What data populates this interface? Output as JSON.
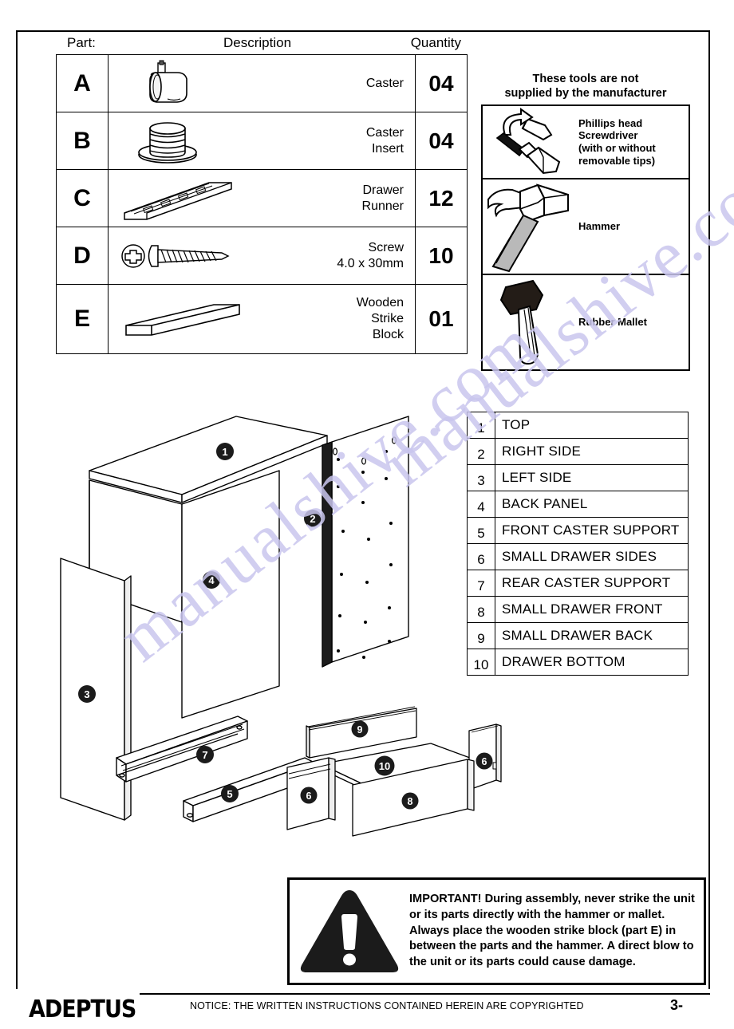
{
  "parts_table": {
    "headers": {
      "part": "Part:",
      "description": "Description",
      "quantity": "Quantity"
    },
    "rows": [
      {
        "letter": "A",
        "icon": "caster-icon",
        "description": "Caster",
        "quantity": "04"
      },
      {
        "letter": "B",
        "icon": "caster-insert-icon",
        "description": "Caster\nInsert",
        "quantity": "04"
      },
      {
        "letter": "C",
        "icon": "drawer-runner-icon",
        "description": "Drawer\nRunner",
        "quantity": "12"
      },
      {
        "letter": "D",
        "icon": "screw-icon",
        "description": "Screw\n4.0 x 30mm",
        "quantity": "10"
      },
      {
        "letter": "E",
        "icon": "strike-block-icon",
        "description": "Wooden\nStrike\nBlock",
        "quantity": "01"
      }
    ]
  },
  "tools": {
    "title": "These tools are not\nsupplied by the manufacturer",
    "items": [
      {
        "icon": "screwdriver-icon",
        "label": "Phillips head\nScrewdriver\n(with or without\nremovable tips)"
      },
      {
        "icon": "hammer-icon",
        "label": "Hammer"
      },
      {
        "icon": "rubber-mallet-icon",
        "label": "Rubber Mallet"
      }
    ]
  },
  "legend": {
    "rows": [
      {
        "num": "1",
        "label": "TOP"
      },
      {
        "num": "2",
        "label": "RIGHT SIDE"
      },
      {
        "num": "3",
        "label": "LEFT SIDE"
      },
      {
        "num": "4",
        "label": "BACK PANEL"
      },
      {
        "num": "5",
        "label": "FRONT CASTER SUPPORT"
      },
      {
        "num": "6",
        "label": "SMALL DRAWER SIDES"
      },
      {
        "num": "7",
        "label": "REAR CASTER SUPPORT"
      },
      {
        "num": "8",
        "label": "SMALL DRAWER FRONT"
      },
      {
        "num": "9",
        "label": "SMALL DRAWER BACK"
      },
      {
        "num": "10",
        "label": "DRAWER BOTTOM"
      }
    ]
  },
  "diagram": {
    "callouts": [
      "1",
      "2",
      "3",
      "4",
      "5",
      "7"
    ],
    "drawer_callouts": [
      "6",
      "6",
      "8",
      "9",
      "10"
    ]
  },
  "warning": {
    "icon": "warning-triangle-icon",
    "text": "IMPORTANT! During assembly, never strike the unit or its parts directly with the hammer or mallet. Always place the wooden strike block (part E) in between the parts and the hammer. A direct blow to the unit or its parts could cause damage."
  },
  "footer": {
    "logo": "ADEPTUS",
    "copyright": "NOTICE: THE WRITTEN INSTRUCTIONS CONTAINED HEREIN ARE COPYRIGHTED",
    "page_number": "3-"
  },
  "watermark": {
    "line1": "manualshive.com",
    "color": "#c9c6ee"
  },
  "colors": {
    "ink": "#000000",
    "paper": "#ffffff",
    "callout_fill": "#1b1b1b",
    "shade_light": "#f2f2f2",
    "shade_mid": "#d8d8d8"
  }
}
